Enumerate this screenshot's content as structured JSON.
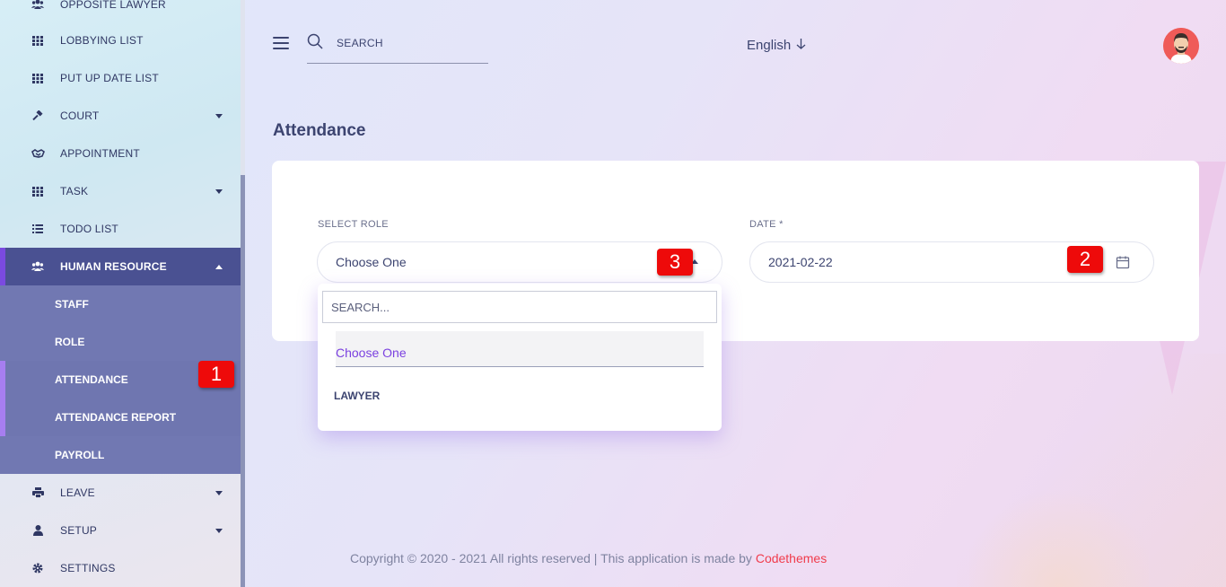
{
  "sidebar": {
    "items": [
      {
        "label": "OPPOSITE LAWYER",
        "icon": "users-icon",
        "has_caret": false
      },
      {
        "label": "LOBBYING LIST",
        "icon": "grid-icon",
        "has_caret": false
      },
      {
        "label": "PUT UP DATE LIST",
        "icon": "grid-icon",
        "has_caret": false
      },
      {
        "label": "COURT",
        "icon": "gavel-icon",
        "has_caret": true
      },
      {
        "label": "APPOINTMENT",
        "icon": "handshake-icon",
        "has_caret": false
      },
      {
        "label": "TASK",
        "icon": "grid-icon",
        "has_caret": true
      },
      {
        "label": "TODO LIST",
        "icon": "list-icon",
        "has_caret": false
      },
      {
        "label": "HUMAN RESOURCE",
        "icon": "users-icon",
        "has_caret": true
      },
      {
        "label": "LEAVE",
        "icon": "print-icon",
        "has_caret": true
      },
      {
        "label": "SETUP",
        "icon": "user-icon",
        "has_caret": true
      },
      {
        "label": "SETTINGS",
        "icon": "gear-icon",
        "has_caret": false
      }
    ],
    "submenu": [
      {
        "label": "STAFF"
      },
      {
        "label": "ROLE"
      },
      {
        "label": "ATTENDANCE"
      },
      {
        "label": "ATTENDANCE REPORT"
      },
      {
        "label": "PAYROLL"
      }
    ]
  },
  "header": {
    "search_placeholder": "SEARCH",
    "language": "English"
  },
  "page": {
    "title": "Attendance"
  },
  "form": {
    "role_label": "SELECT ROLE",
    "role_value": "Choose One",
    "date_label": "DATE *",
    "date_value": "2021-02-22"
  },
  "dropdown": {
    "search_placeholder": "SEARCH...",
    "options": [
      "Choose One",
      "LAWYER"
    ]
  },
  "markers": [
    "1",
    "2",
    "3"
  ],
  "footer": {
    "text": "Copyright © 2020 - 2021 All rights reserved | This application is made by ",
    "brand": "Codethemes"
  },
  "colors": {
    "sidebar_active": "#4a5192",
    "submenu_bg": "#7178b2",
    "accent_purple": "#7b41e0",
    "marker_red": "#ee0a0a",
    "brand_red": "#f03c4c"
  }
}
